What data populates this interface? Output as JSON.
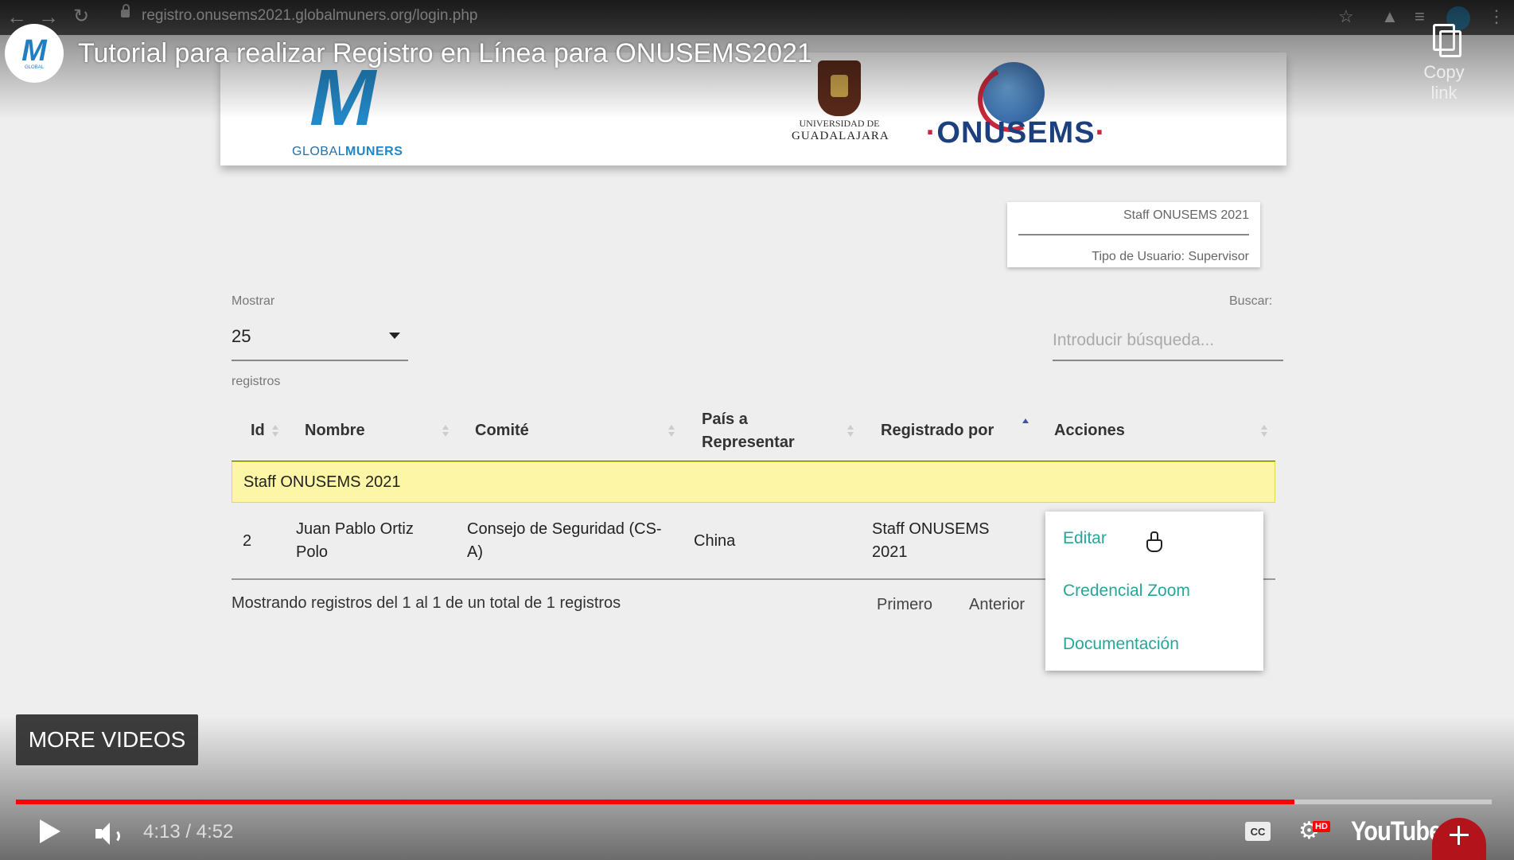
{
  "browser": {
    "url": "registro.onusems2021.globalmuners.org/login.php"
  },
  "youtube": {
    "video_title": "Tutorial para realizar Registro en Línea para ONUSEMS2021",
    "copy_link_label": "Copy link",
    "more_videos_label": "MORE VIDEOS",
    "time_display": "4:13 / 4:52",
    "progress_fraction": 0.8664,
    "cc_label": "CC",
    "hd_badge": "HD",
    "brand": "YouTube",
    "accent_color": "#ff0000"
  },
  "header": {
    "globalmuners_logo_prefix": "GLOBAL",
    "globalmuners_logo_suffix": "MUNERS",
    "udg_line1": "UNIVERSIDAD DE",
    "udg_line2": "GUADALAJARA",
    "onusems_logo": "ONUSEMS"
  },
  "user_card": {
    "name": "Staff ONUSEMS 2021",
    "role": "Tipo de Usuario: Supervisor"
  },
  "controls": {
    "show_label": "Mostrar",
    "show_value": "25",
    "records_label": "registros",
    "search_label": "Buscar:",
    "search_placeholder": "Introducir búsqueda..."
  },
  "table": {
    "headers": {
      "id": "Id",
      "nombre": "Nombre",
      "comite": "Comité",
      "pais_line1": "País a",
      "pais_line2": "Representar",
      "registrado": "Registrado por",
      "acciones": "Acciones"
    },
    "group_label": "Staff ONUSEMS 2021",
    "rows": [
      {
        "id": "2",
        "nombre_line1": "Juan Pablo Ortiz",
        "nombre_line2": "Polo",
        "comite_line1": "Consejo de Seguridad (CS-",
        "comite_line2": "A)",
        "pais": "China",
        "registrado_line1": "Staff ONUSEMS",
        "registrado_line2": "2021"
      }
    ],
    "info": "Mostrando registros del 1 al 1 de un total de 1 registros",
    "pagination": {
      "first": "Primero",
      "previous": "Anterior"
    }
  },
  "actions_menu": {
    "items": [
      "Editar",
      "Credencial Zoom",
      "Documentación"
    ],
    "color": "#26a69a"
  }
}
